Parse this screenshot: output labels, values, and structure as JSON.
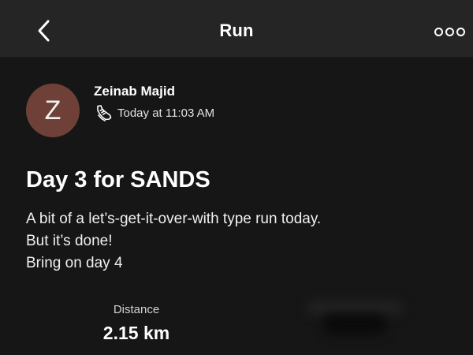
{
  "header": {
    "title": "Run",
    "back_icon": "chevron-left-icon",
    "more_icon": "more-options-icon"
  },
  "athlete": {
    "name": "Zeinab Majid",
    "initial": "Z",
    "avatar_color": "#6e4038",
    "activity_icon": "running-shoe-icon",
    "timestamp": "Today at 11:03 AM"
  },
  "activity": {
    "title": "Day 3 for SANDS",
    "description_lines": [
      "A bit of a let’s-get-it-over-with type run today.",
      "But it’s done!",
      "Bring on day 4"
    ]
  },
  "stats": [
    {
      "label": "Distance",
      "value": "2.15 km"
    }
  ]
}
